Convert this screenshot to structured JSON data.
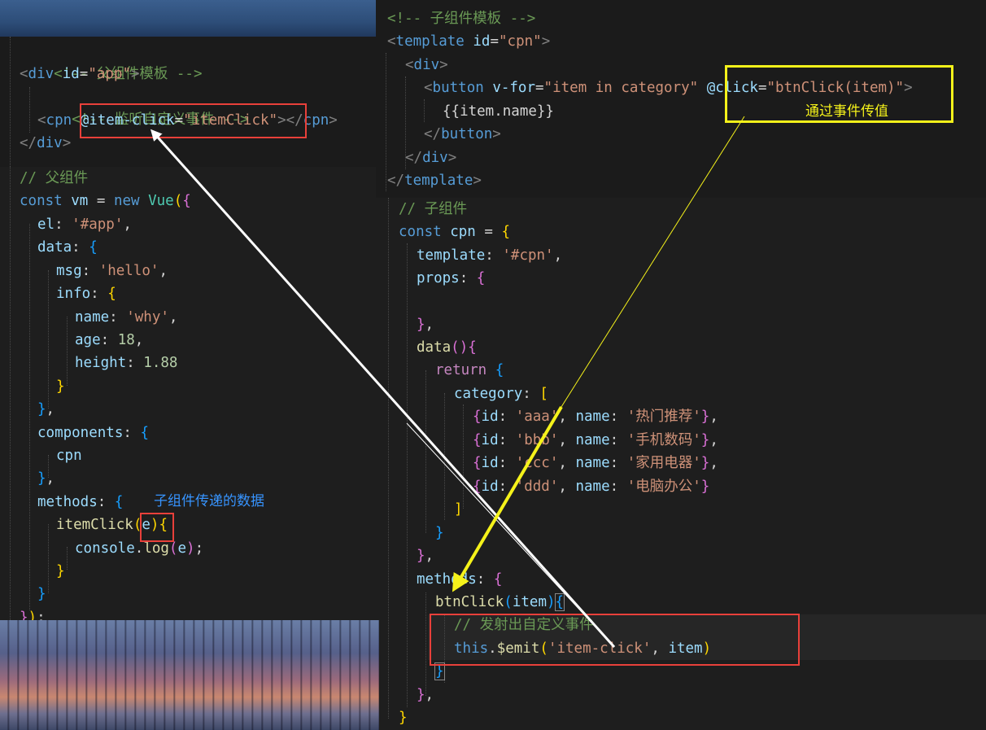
{
  "parent_template": {
    "line1": "<!-- 父组件模板 -->",
    "line2_tag": "div",
    "line2_attr": "id",
    "line2_val": "\"app\"",
    "line3": "<!-- 监听自定义事件 -->",
    "line4_tag": "cpn",
    "line4_event": "@item-click",
    "line4_val": "\"itemClick\"",
    "line4_close": "cpn",
    "line5_tag": "div"
  },
  "parent_script": {
    "comment": "// 父组件",
    "const_kw": "const",
    "vm": "vm",
    "new_kw": "new",
    "vue_cls": "Vue",
    "el_key": "el",
    "el_val": "'#app'",
    "data_key": "data",
    "msg_key": "msg",
    "msg_val": "'hello'",
    "info_key": "info",
    "name_key": "name",
    "name_val": "'why'",
    "age_key": "age",
    "age_val": "18",
    "height_key": "height",
    "height_val": "1.88",
    "components_key": "components",
    "cpn_item": "cpn",
    "methods_key": "methods",
    "itemclick_fn": "itemClick",
    "itemclick_param": "e",
    "console_obj": "console",
    "log_fn": "log",
    "log_arg": "e"
  },
  "child_template": {
    "line1": "<!-- 子组件模板 -->",
    "template_tag": "template",
    "id_attr": "id",
    "id_val": "\"cpn\"",
    "div_tag": "div",
    "button_tag": "button",
    "vfor_attr": "v-for",
    "vfor_val": "\"item in category\"",
    "click_attr": "@click",
    "click_val": "\"btnClick(item)\"",
    "mustache": "{{item.name}}"
  },
  "child_script": {
    "comment": "// 子组件",
    "const_kw": "const",
    "cpn": "cpn",
    "template_key": "template",
    "template_val": "'#cpn'",
    "props_key": "props",
    "data_fn": "data",
    "return_kw": "return",
    "category_key": "category",
    "items": [
      {
        "id": "'aaa'",
        "name": "'热门推荐'"
      },
      {
        "id": "'bbb'",
        "name": "'手机数码'"
      },
      {
        "id": "'ccc'",
        "name": "'家用电器'"
      },
      {
        "id": "'ddd'",
        "name": "'电脑办公'"
      }
    ],
    "id_key": "id",
    "name_key": "name",
    "methods_key": "methods",
    "btnclick_fn": "btnClick",
    "btnclick_param": "item",
    "emit_comment": "// 发射出自定义事件",
    "this_kw": "this",
    "emit_fn": "$emit",
    "emit_event": "'item-click'",
    "emit_arg": "item"
  },
  "annotations": {
    "event_pass": "通过事件传值",
    "child_data": "子组件传递的数据"
  },
  "colors": {
    "red_box": "#e8403a",
    "yellow_box": "#f5f21a",
    "white_arrow": "#ffffff",
    "annotation_blue": "#3794ff"
  }
}
